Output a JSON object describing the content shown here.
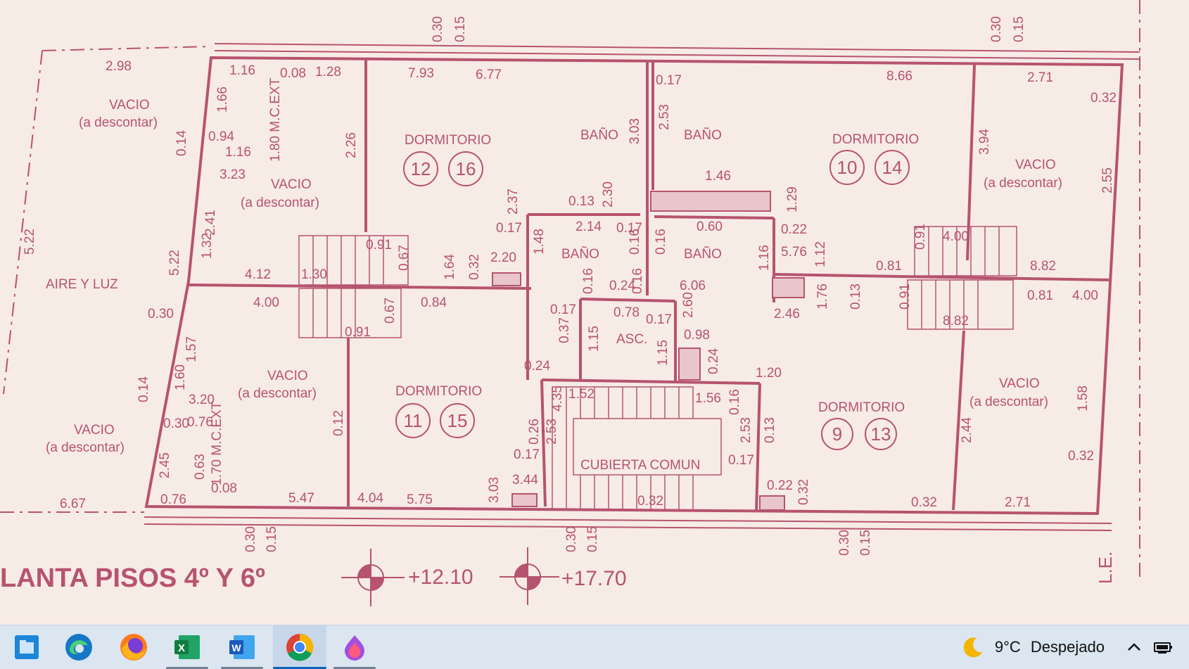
{
  "plan": {
    "title": "LANTA PISOS 4º Y 6º",
    "levels": [
      "+12.10",
      "+17.70"
    ],
    "line_label": "L.E.",
    "rooms": {
      "vacio": "VACIO",
      "descontar": "(a  descontar)",
      "aire_luz": "AIRE  Y  LUZ",
      "dormitorio": "DORMITORIO",
      "bano": "BAÑO",
      "asc": "ASC.",
      "cubierta": "CUBIERTA  COMUN",
      "mcext": "1.80 M.C.EXT",
      "mcext2": "1.70 M.C.EXT"
    },
    "unit_numbers": [
      "12",
      "16",
      "10",
      "14",
      "11",
      "15",
      "9",
      "13"
    ],
    "dims": [
      "0.30",
      "0.15",
      "2.98",
      "1.16",
      "0.08",
      "1.28",
      "7.93",
      "6.77",
      "0.17",
      "8.66",
      "2.71",
      "0.32",
      "1.66",
      "0.14",
      "0.94",
      "3.23",
      "2.26",
      "2.53",
      "3.03",
      "3.94",
      "2.55",
      "2.41",
      "1.32",
      "2.37",
      "0.13",
      "2.30",
      "1.46",
      "1.29",
      "4.00",
      "8.82",
      "5.22",
      "4.12",
      "1.30",
      "0.91",
      "0.67",
      "1.64",
      "2.20",
      "1.48",
      "2.14",
      "0.16",
      "0.60",
      "0.22",
      "5.76",
      "1.12",
      "0.81",
      "0.24",
      "6.06",
      "1.76",
      "0.84",
      "0.78",
      "2.60",
      "2.46",
      "1.57",
      "1.60",
      "0.37",
      "1.15",
      "0.98",
      "1.20",
      "3.20",
      "0.76",
      "0.12",
      "1.52",
      "4.35",
      "1.56",
      "1.58",
      "2.45",
      "0.63",
      "0.26",
      "3.44",
      "3.03",
      "2.44",
      "6.67",
      "5.47",
      "4.04",
      "5.75",
      "0.32",
      "0.32"
    ]
  },
  "taskbar": {
    "apps": [
      {
        "name": "file-explorer",
        "active": false
      },
      {
        "name": "edge",
        "active": false
      },
      {
        "name": "firefox",
        "active": false
      },
      {
        "name": "excel",
        "active": false
      },
      {
        "name": "word",
        "active": false
      },
      {
        "name": "chrome",
        "active": true
      },
      {
        "name": "app",
        "active": false
      }
    ],
    "weather": {
      "icon": "moon-icon",
      "temp": "9°C",
      "condition": "Despejado"
    },
    "tray_icons": [
      "chevron-up-icon",
      "network-icon"
    ]
  },
  "colors": {
    "ink": "#b6546e",
    "paper": "#f7ebe6",
    "taskbar": "#dbe6f1",
    "accent": "#0a63b8"
  }
}
